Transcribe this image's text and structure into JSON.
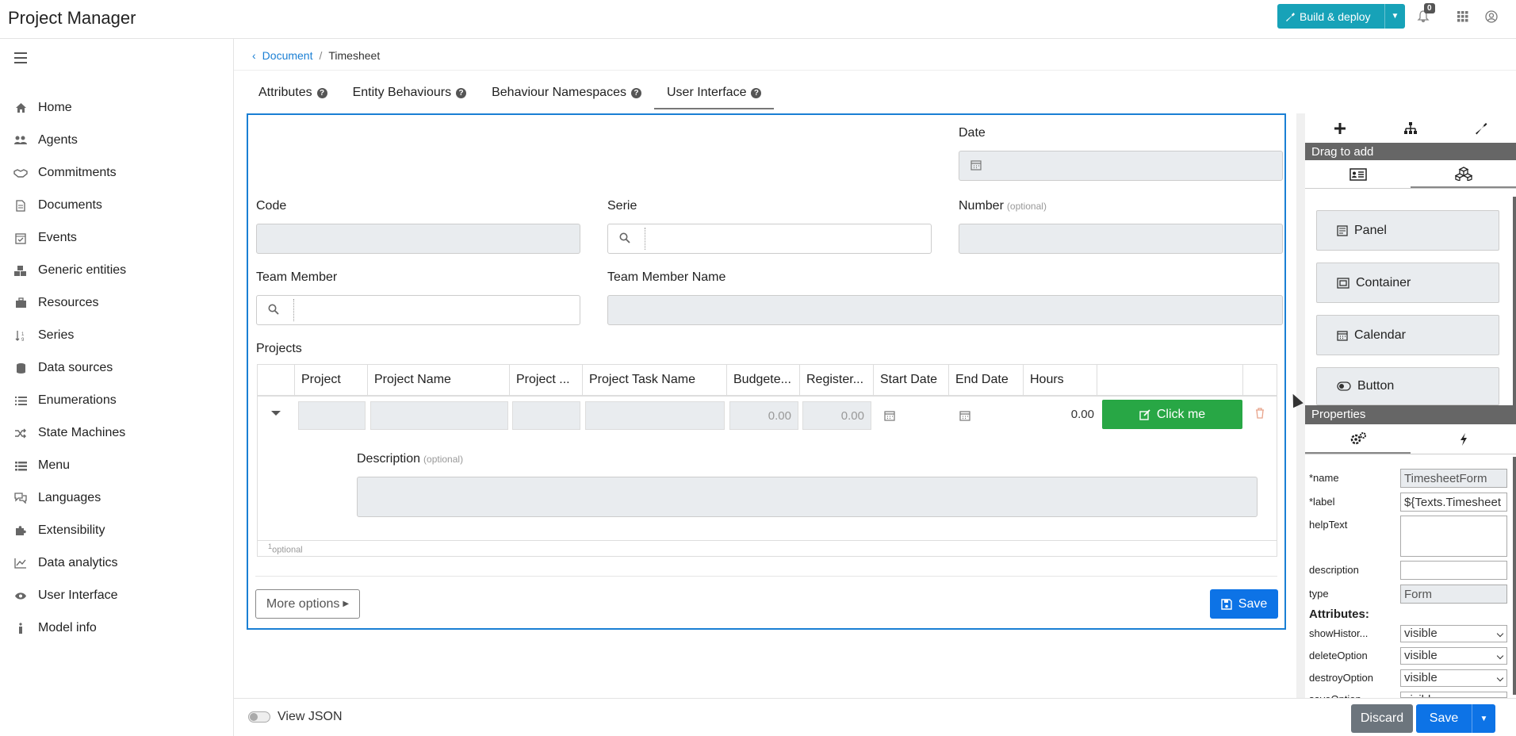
{
  "app": {
    "title": "Project Manager",
    "notifications_count": "0"
  },
  "header": {
    "build_label": "Build & deploy"
  },
  "sidebar": {
    "items": [
      {
        "label": "Home",
        "icon": "home-icon"
      },
      {
        "label": "Agents",
        "icon": "users-icon"
      },
      {
        "label": "Commitments",
        "icon": "handshake-icon"
      },
      {
        "label": "Documents",
        "icon": "document-icon"
      },
      {
        "label": "Events",
        "icon": "calendar-check-icon"
      },
      {
        "label": "Generic entities",
        "icon": "cubes-icon"
      },
      {
        "label": "Resources",
        "icon": "briefcase-icon"
      },
      {
        "label": "Series",
        "icon": "sort-numeric-icon"
      },
      {
        "label": "Data sources",
        "icon": "database-icon"
      },
      {
        "label": "Enumerations",
        "icon": "list-icon"
      },
      {
        "label": "State Machines",
        "icon": "random-icon"
      },
      {
        "label": "Menu",
        "icon": "menu-list-icon"
      },
      {
        "label": "Languages",
        "icon": "speech-icon"
      },
      {
        "label": "Extensibility",
        "icon": "puzzle-icon"
      },
      {
        "label": "Data analytics",
        "icon": "chart-line-icon"
      },
      {
        "label": "User Interface",
        "icon": "eye-icon"
      },
      {
        "label": "Model info",
        "icon": "info-icon"
      }
    ]
  },
  "breadcrumb": {
    "parent": "Document",
    "separator": "/",
    "current": "Timesheet"
  },
  "tabs": [
    {
      "label": "Attributes"
    },
    {
      "label": "Entity Behaviours"
    },
    {
      "label": "Behaviour Namespaces"
    },
    {
      "label": "User Interface"
    }
  ],
  "form": {
    "date_label": "Date",
    "code_label": "Code",
    "serie_label": "Serie",
    "number_label": "Number",
    "optional_text": "(optional)",
    "team_member_label": "Team Member",
    "team_member_name_label": "Team Member Name",
    "projects_label": "Projects",
    "grid": {
      "columns": [
        "Project",
        "Project Name",
        "Project ...",
        "Project Task Name",
        "Budgete...",
        "Register...",
        "Start Date",
        "End Date",
        "Hours"
      ],
      "row": {
        "budgeted": "0.00",
        "registered": "0.00",
        "hours": "0.00",
        "button_label": "Click me"
      },
      "description_label": "Description",
      "footnote_sup": "1",
      "footnote_text": "optional"
    },
    "more_options_label": "More options",
    "save_label": "Save"
  },
  "right_panel": {
    "drag_to_add": "Drag to add",
    "components": [
      "Panel",
      "Container",
      "Calendar",
      "Button"
    ],
    "properties_title": "Properties",
    "props": {
      "name_label": "*name",
      "name_value": "TimesheetForm",
      "label_label": "*label",
      "label_value": "${Texts.Timesheet",
      "helptext_label": "helpText",
      "description_label": "description",
      "type_label": "type",
      "type_value": "Form",
      "attributes_heading": "Attributes:",
      "show_history_label": "showHistor...",
      "show_history_value": "visible",
      "delete_option_label": "deleteOption",
      "delete_option_value": "visible",
      "destroy_option_label": "destroyOption",
      "destroy_option_value": "visible",
      "save_option_label": "saveOption",
      "save_option_value": "visible"
    }
  },
  "footer": {
    "view_json_label": "View JSON",
    "discard_label": "Discard",
    "save_label": "Save"
  },
  "colors": {
    "accent": "#0d73e6",
    "teal": "#17a2b8",
    "green": "#28a745",
    "gray_button": "#6c757d"
  }
}
